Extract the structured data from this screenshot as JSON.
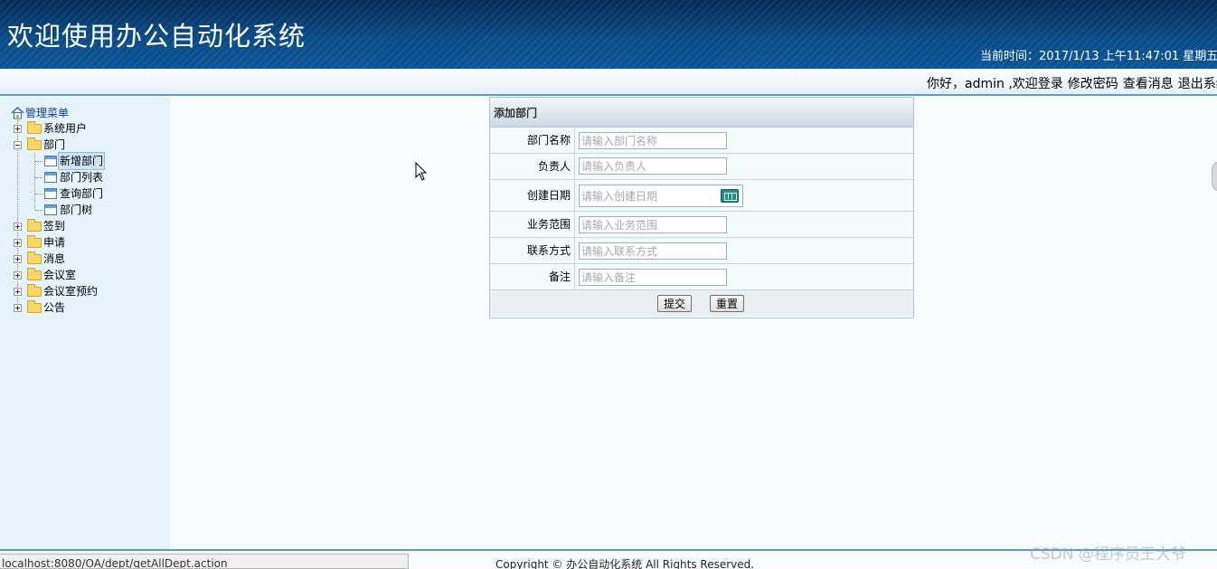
{
  "header": {
    "app_title": "欢迎使用办公自动化系统",
    "clock_text": "当前时间：2017/1/13 上午11:47:01 星期五"
  },
  "userbar": {
    "greeting": "你好，admin ,欢迎登录",
    "links": [
      "修改密码",
      "查看消息",
      "退出系统"
    ]
  },
  "sidebar": {
    "root": "管理菜单",
    "items": [
      {
        "label": "系统用户",
        "expanded": false
      },
      {
        "label": "部门",
        "expanded": true,
        "children": [
          "新增部门",
          "部门列表",
          "查询部门",
          "部门树"
        ],
        "selected": "新增部门"
      },
      {
        "label": "签到",
        "expanded": false
      },
      {
        "label": "申请",
        "expanded": false
      },
      {
        "label": "消息",
        "expanded": false
      },
      {
        "label": "会议室",
        "expanded": false
      },
      {
        "label": "会议室预约",
        "expanded": false
      },
      {
        "label": "公告",
        "expanded": false
      }
    ]
  },
  "form": {
    "title": "添加部门",
    "fields": [
      {
        "label": "部门名称",
        "placeholder": "请输入部门名称",
        "value": ""
      },
      {
        "label": "负责人",
        "placeholder": "请输入负责人",
        "value": ""
      },
      {
        "label": "创建日期",
        "placeholder": "请输入创建日期",
        "value": ""
      },
      {
        "label": "业务范围",
        "placeholder": "请输入业务范围",
        "value": ""
      },
      {
        "label": "联系方式",
        "placeholder": "请输入联系方式",
        "value": ""
      },
      {
        "label": "备注",
        "placeholder": "请输入备注",
        "value": ""
      }
    ],
    "submit_label": "提交",
    "reset_label": "重置"
  },
  "footer": {
    "copyright": "Copyright © 办公自动化系统 All Rights Reserved.",
    "status_url": "localhost:8080/OA/dept/getAllDept.action",
    "watermark": "CSDN @程序员王大爷"
  },
  "colors": {
    "header_dark": "#062d56",
    "header_light": "#0b5597",
    "accent_border": "#5b9bd5",
    "sidebar_bg": "#e7f3fa",
    "content_bg": "#f7fbfb"
  },
  "icons": {
    "home": "home-icon",
    "folder": "folder-icon",
    "page": "page-icon",
    "calendar": "calendar-icon",
    "cursor": "mouse-pointer-icon"
  }
}
